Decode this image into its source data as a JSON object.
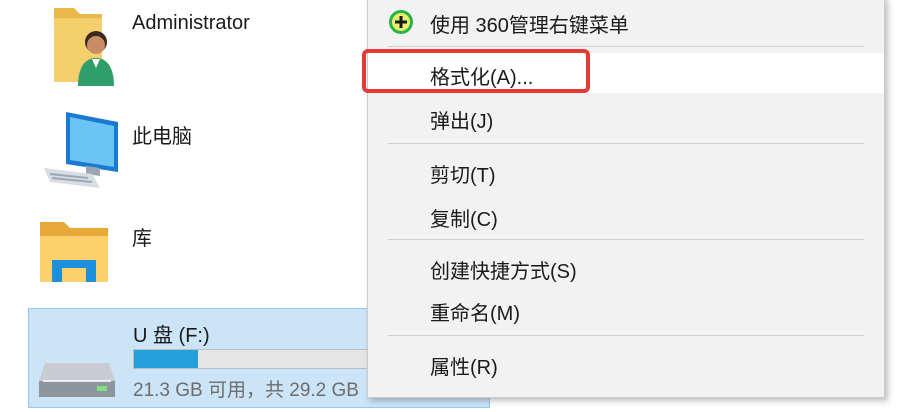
{
  "explorer": {
    "items": [
      {
        "label": "Administrator",
        "icon": "user-folder-icon"
      },
      {
        "label": "此电脑",
        "icon": "computer-icon"
      },
      {
        "label": "库",
        "icon": "library-folder-icon"
      }
    ],
    "drive": {
      "label": "U 盘 (F:)",
      "icon": "usb-drive-icon",
      "free_text": "21.3 GB 可用，共 29.2 GB",
      "used_fraction": 0.27
    }
  },
  "context_menu": {
    "items": [
      {
        "label": "使用 360管理右键菜单",
        "icon": "360-plus-icon"
      },
      {
        "label": "格式化(A)...",
        "highlighted": true,
        "annotated": true
      },
      {
        "label": "弹出(J)"
      },
      {
        "label": "剪切(T)"
      },
      {
        "label": "复制(C)"
      },
      {
        "label": "创建快捷方式(S)"
      },
      {
        "label": "重命名(M)"
      },
      {
        "label": "属性(R)"
      }
    ]
  },
  "colors": {
    "selection_bg": "#cce4f7",
    "selection_border": "#99c9ef",
    "progress_fill": "#26a0da",
    "menu_bg": "#f2f2f2",
    "annotation": "#e53935",
    "icon_360": "#27b34a"
  }
}
